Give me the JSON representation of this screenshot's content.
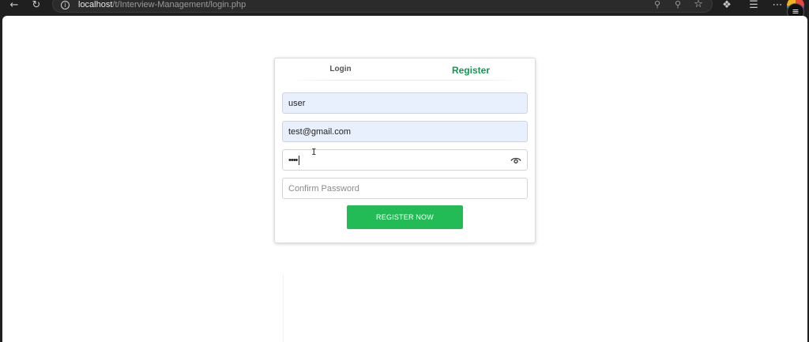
{
  "browser": {
    "url_host": "localhost",
    "url_path": "/t/Interview-Management/login.php",
    "icons": {
      "back": "arrow-left-icon",
      "reload": "reload-icon",
      "site_info": "info-icon",
      "password_manager": "key-icon",
      "zoom": "zoom-icon",
      "favorite": "star-icon",
      "extensions": "puzzle-icon",
      "favorites": "favorites-icon",
      "more": "more-icon",
      "profile": "profile-avatar-icon"
    }
  },
  "auth_card": {
    "tabs": {
      "login_label": "Login",
      "register_label": "Register",
      "active": "register",
      "active_color": "#119a52"
    },
    "fields": {
      "username_value": "user",
      "email_value": "test@gmail.com",
      "password_masked": "••••",
      "confirm_placeholder": "Confirm Password"
    },
    "submit_label": "REGISTER NOW",
    "submit_color": "#22bb55"
  }
}
